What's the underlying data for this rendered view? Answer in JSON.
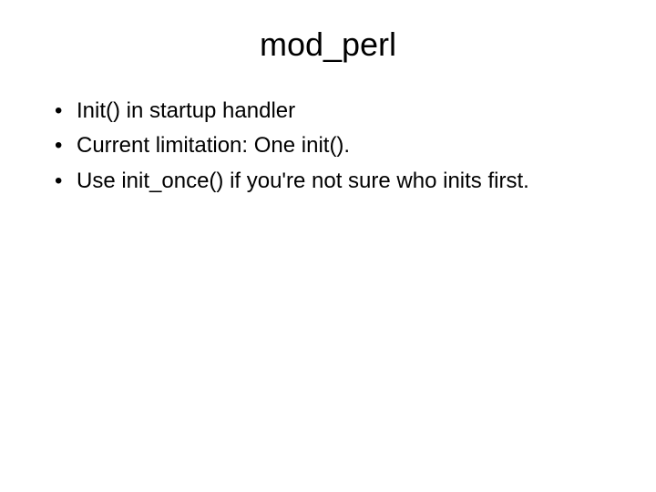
{
  "slide": {
    "title": "mod_perl",
    "bullets": [
      "Init() in startup handler",
      "Current limitation: One init().",
      "Use init_once() if you're not sure who inits first."
    ]
  }
}
